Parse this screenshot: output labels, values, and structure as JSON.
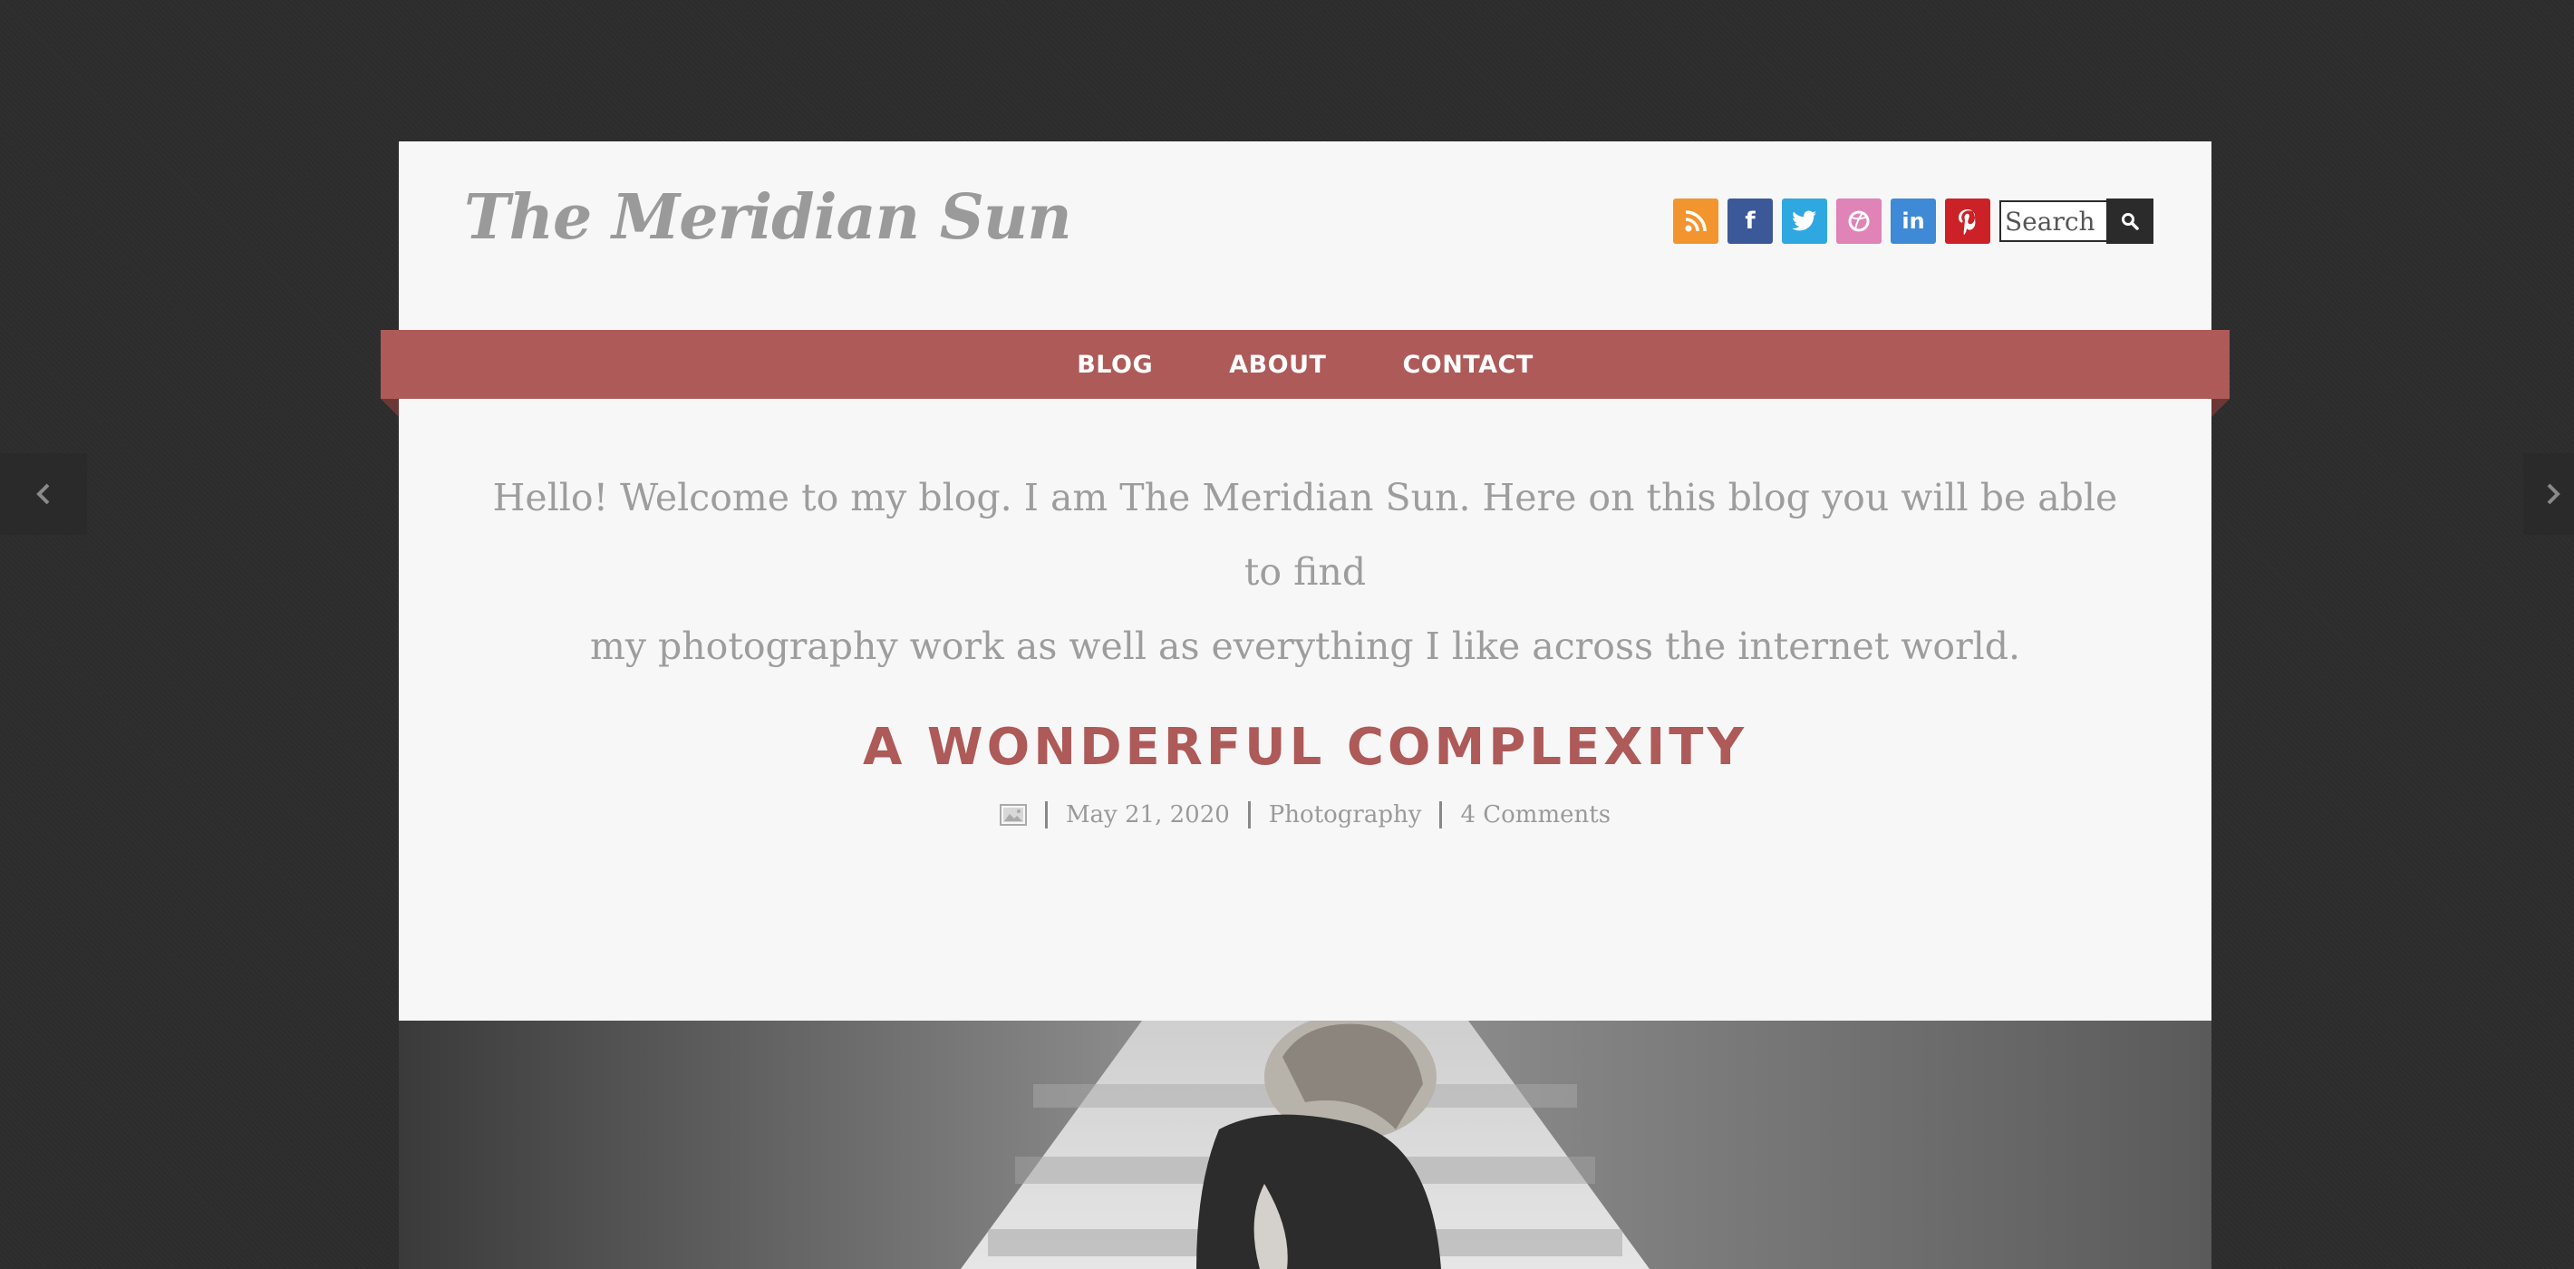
{
  "site": {
    "title": "The Meridian Sun"
  },
  "header": {
    "social_icons": [
      {
        "name": "rss-icon",
        "color": "#f2952f"
      },
      {
        "name": "facebook-icon",
        "color": "#3b5998"
      },
      {
        "name": "twitter-icon",
        "color": "#2fa8e1"
      },
      {
        "name": "dribbble-icon",
        "color": "#e083b7"
      },
      {
        "name": "linkedin-icon",
        "color": "#3f8ad6"
      },
      {
        "name": "pinterest-icon",
        "color": "#cc2127"
      }
    ],
    "search": {
      "placeholder": "Search"
    }
  },
  "nav": {
    "items": [
      "Blog",
      "About",
      "Contact"
    ]
  },
  "intro": {
    "line1": "Hello! Welcome to my blog. I am The Meridian Sun. Here on this blog you will be able to find",
    "line2": "my photography work as well as everything I like across the internet world."
  },
  "post": {
    "title": "A Wonderful Complexity",
    "format_icon": "image-format-icon",
    "date": "May 21, 2020",
    "category": "Photography",
    "comments": "4 Comments"
  },
  "colors": {
    "accent": "#ad5a58",
    "background": "#2d2d2d",
    "panel": "#f7f7f7",
    "text_muted": "#9d9d9d"
  }
}
